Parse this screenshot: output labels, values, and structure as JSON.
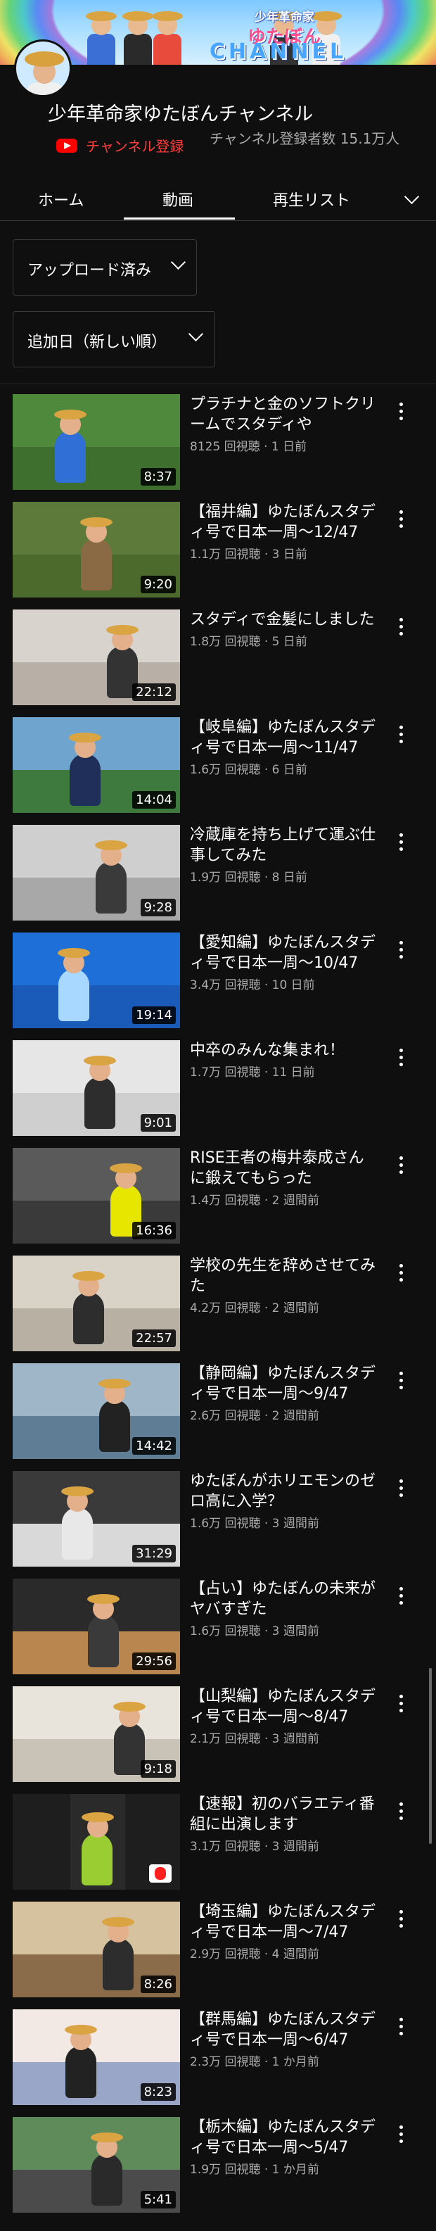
{
  "banner": {
    "logo_top": "少年革命家",
    "logo_main": "ゆたぼん",
    "logo_channel": "CHANNEL"
  },
  "channel": {
    "title": "少年革命家ゆたぼんチャンネル",
    "subscribe_label": "チャンネル登録",
    "subscriber_count": "チャンネル登録者数 15.1万人"
  },
  "tabs": [
    {
      "label": "ホーム"
    },
    {
      "label": "動画"
    },
    {
      "label": "再生リスト"
    }
  ],
  "filters": {
    "upload_type": "アップロード済み",
    "sort_order": "追加日（新しい順）"
  },
  "videos": [
    {
      "title": "プラチナと金のソフトクリームでスタディや",
      "meta": "8125 回視聴 · 1 日前",
      "duration": "8:37"
    },
    {
      "title": "【福井編】ゆたぼんスタディ号で日本一周〜12/47",
      "meta": "1.1万 回視聴 · 3 日前",
      "duration": "9:20"
    },
    {
      "title": "スタディで金髪にしました",
      "meta": "1.8万 回視聴 · 5 日前",
      "duration": "22:12"
    },
    {
      "title": "【岐阜編】ゆたぼんスタディ号で日本一周〜11/47",
      "meta": "1.6万 回視聴 · 6 日前",
      "duration": "14:04"
    },
    {
      "title": "冷蔵庫を持ち上げて運ぶ仕事してみた",
      "meta": "1.9万 回視聴 · 8 日前",
      "duration": "9:28"
    },
    {
      "title": "【愛知編】ゆたぼんスタディ号で日本一周〜10/47",
      "meta": "3.4万 回視聴 · 10 日前",
      "duration": "19:14"
    },
    {
      "title": "中卒のみんな集まれ！",
      "meta": "1.7万 回視聴 · 11 日前",
      "duration": "9:01"
    },
    {
      "title": "RISE王者の梅井泰成さんに鍛えてもらった",
      "meta": "1.4万 回視聴 · 2 週間前",
      "duration": "16:36"
    },
    {
      "title": "学校の先生を辞めさせてみた",
      "meta": "4.2万 回視聴 · 2 週間前",
      "duration": "22:57"
    },
    {
      "title": "【静岡編】ゆたぼんスタディ号で日本一周〜9/47",
      "meta": "2.6万 回視聴 · 2 週間前",
      "duration": "14:42"
    },
    {
      "title": "ゆたぼんがホリエモンのゼロ高に入学？",
      "meta": "1.6万 回視聴 · 3 週間前",
      "duration": "31:29"
    },
    {
      "title": "【占い】ゆたぼんの未来がヤバすぎた",
      "meta": "1.6万 回視聴 · 3 週間前",
      "duration": "29:56"
    },
    {
      "title": "【山梨編】ゆたぼんスタディ号で日本一周〜8/47",
      "meta": "2.1万 回視聴 · 3 週間前",
      "duration": "9:18"
    },
    {
      "title": "【速報】初のバラエティ番組に出演します",
      "meta": "3.1万 回視聴 · 3 週間前",
      "duration": ""
    },
    {
      "title": "【埼玉編】ゆたぼんスタディ号で日本一周〜7/47",
      "meta": "2.9万 回視聴 · 4 週間前",
      "duration": "8:26"
    },
    {
      "title": "【群馬編】ゆたぼんスタディ号で日本一周〜6/47",
      "meta": "2.3万 回視聴 · 1 か月前",
      "duration": "8:23"
    },
    {
      "title": "【栃木編】ゆたぼんスタディ号で日本一周〜5/47",
      "meta": "1.9万 回視聴 · 1 か月前",
      "duration": "5:41"
    }
  ],
  "colors": {
    "background": "#0f0f0f",
    "subscribe_red": "#ff3d3d",
    "meta_gray": "#aaaaaa"
  }
}
